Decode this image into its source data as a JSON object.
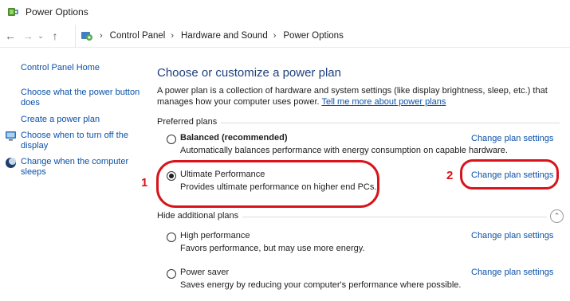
{
  "window": {
    "title": "Power Options"
  },
  "nav": {
    "breadcrumb": [
      "Control Panel",
      "Hardware and Sound",
      "Power Options"
    ]
  },
  "sidebar": {
    "home": "Control Panel Home",
    "links": [
      "Choose what the power button does",
      "Create a power plan",
      "Choose when to turn off the display",
      "Change when the computer sleeps"
    ]
  },
  "main": {
    "title": "Choose or customize a power plan",
    "intro": "A power plan is a collection of hardware and system settings (like display brightness, sleep, etc.) that manages how your computer uses power.",
    "intro_link": "Tell me more about power plans",
    "preferred_label": "Preferred plans",
    "hidden_label": "Hide additional plans",
    "change_label": "Change plan settings",
    "plans": [
      {
        "name": "Balanced (recommended)",
        "desc": "Automatically balances performance with energy consumption on capable hardware.",
        "selected": false
      },
      {
        "name": "Ultimate Performance",
        "desc": "Provides ultimate performance on higher end PCs.",
        "selected": true
      },
      {
        "name": "High performance",
        "desc": "Favors performance, but may use more energy.",
        "selected": false
      },
      {
        "name": "Power saver",
        "desc": "Saves energy by reducing your computer's performance where possible.",
        "selected": false
      }
    ]
  },
  "annotations": {
    "one": "1",
    "two": "2",
    "color": "#d8131b"
  },
  "colors": {
    "link": "#0b51a8",
    "title": "#1f3f7a"
  },
  "icons": [
    "power-options-icon",
    "back-arrow-icon",
    "forward-arrow-icon",
    "recent-chevron-icon",
    "up-arrow-icon",
    "control-panel-icon",
    "display-monitor-icon",
    "sleep-moon-icon",
    "collapse-chevron-icon"
  ]
}
